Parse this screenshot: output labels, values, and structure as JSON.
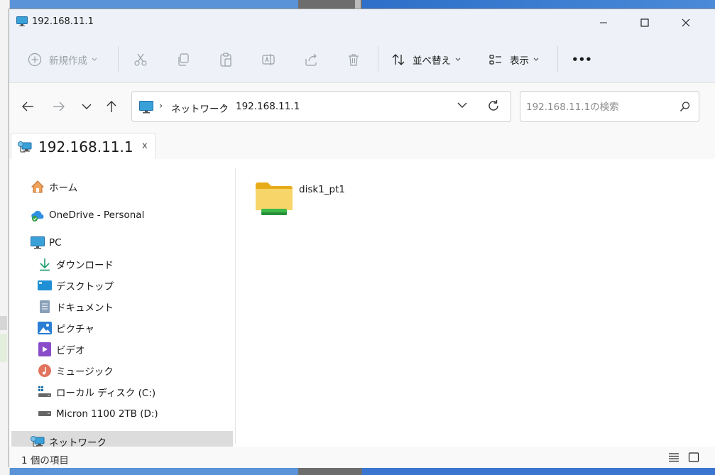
{
  "window": {
    "title": "192.168.11.1"
  },
  "toolbar": {
    "new_label": "新規作成",
    "sort_label": "並べ替え",
    "view_label": "表示",
    "more_label": "•••"
  },
  "address": {
    "crumbs": [
      "ネットワーク",
      "192.168.11.1"
    ]
  },
  "search": {
    "placeholder": "192.168.11.1の検索"
  },
  "tab": {
    "title": "192.168.11.1",
    "close": "x"
  },
  "sidebar": {
    "items": [
      {
        "label": "ホーム"
      },
      {
        "label": "OneDrive - Personal"
      },
      {
        "label": "PC"
      },
      {
        "label": "ダウンロード"
      },
      {
        "label": "デスクトップ"
      },
      {
        "label": "ドキュメント"
      },
      {
        "label": "ピクチャ"
      },
      {
        "label": "ビデオ"
      },
      {
        "label": "ミュージック"
      },
      {
        "label": "ローカル ディスク (C:)"
      },
      {
        "label": "Micron 1100 2TB (D:)"
      },
      {
        "label": "ネットワーク"
      }
    ]
  },
  "files": [
    {
      "name": "disk1_pt1"
    }
  ],
  "status": {
    "count": "1 個の項目"
  },
  "colors": {
    "selected": "#dcdcdc",
    "accent": "#0067c0",
    "folder": "#f4c94d"
  }
}
